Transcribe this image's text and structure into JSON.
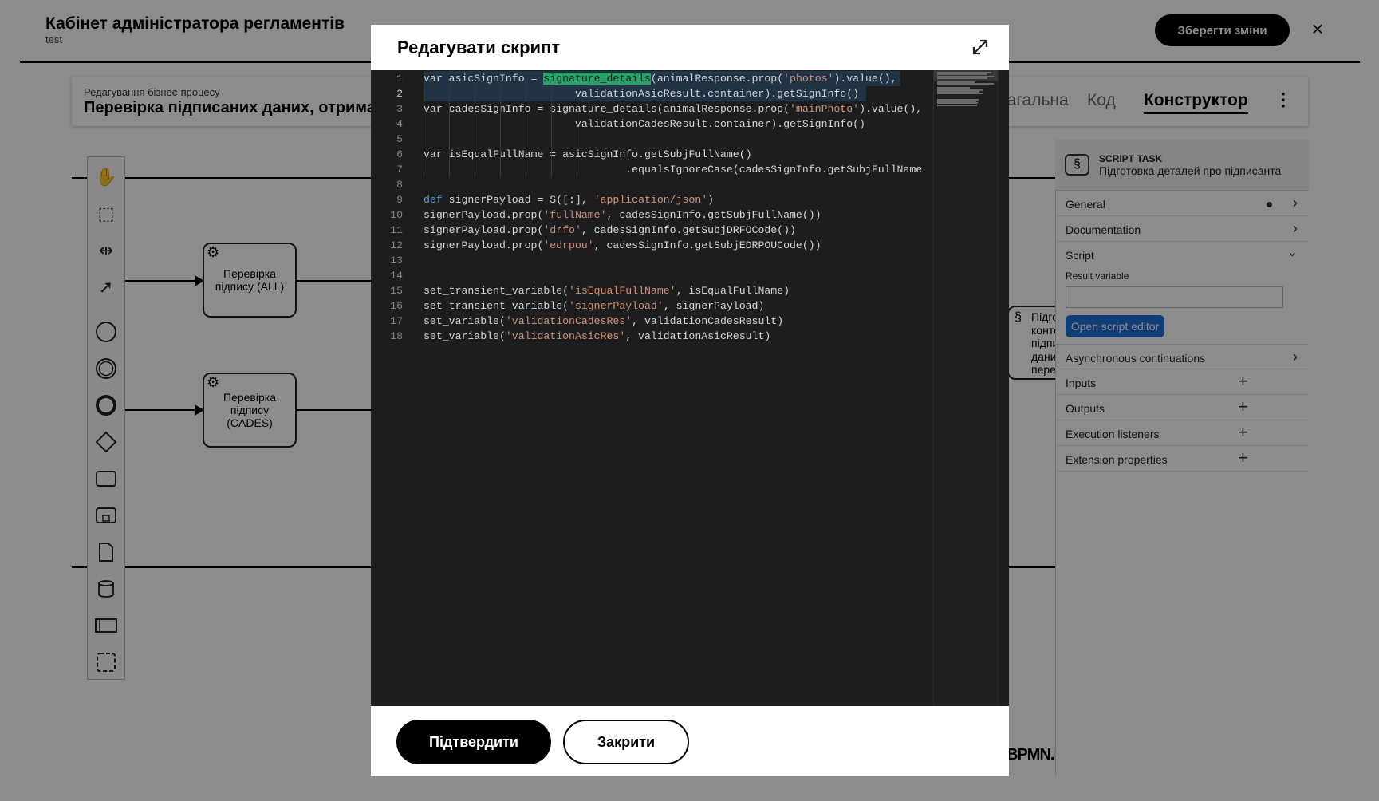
{
  "header": {
    "title": "Кабінет адміністратора регламентів",
    "subtitle": "test",
    "save_label": "Зберегти зміни",
    "close_glyph": "×"
  },
  "process": {
    "label": "Редагування бізнес-процесу",
    "name": "Перевірка підписаних даних, отримання деталей про підписанта та перевірка"
  },
  "tabs": [
    {
      "label": "Загальна"
    },
    {
      "label": "Код"
    },
    {
      "label": "Конструктор",
      "active": true
    }
  ],
  "menu_glyph": "⋮",
  "palette": {
    "tools": [
      "hand-tool-icon",
      "lasso-tool-icon",
      "space-tool-icon",
      "connect-tool-icon",
      "start-event-icon",
      "intermediate-event-icon",
      "end-event-icon",
      "gateway-icon",
      "task-icon",
      "subprocess-icon",
      "data-object-icon",
      "data-store-icon",
      "pool-icon",
      "group-icon"
    ]
  },
  "diagram": {
    "task1": "Перевірка підпису (ALL)",
    "task2": "Перевірка підпису (CADES)",
    "task3_lines": [
      "Підго",
      "конте",
      "підпи",
      "дани",
      "пере"
    ],
    "watermark": "BPMN.iO"
  },
  "properties": {
    "type": "SCRIPT TASK",
    "name": "Підготовка деталей про підписанта",
    "groups": [
      {
        "label": "General",
        "control": "chevron",
        "dot": true
      },
      {
        "label": "Documentation",
        "control": "chevron"
      },
      {
        "label": "Script",
        "control": "chevron-down"
      },
      {
        "label": "Asynchronous continuations",
        "control": "chevron"
      },
      {
        "label": "Inputs",
        "control": "plus"
      },
      {
        "label": "Outputs",
        "control": "plus"
      },
      {
        "label": "Execution listeners",
        "control": "plus"
      },
      {
        "label": "Extension properties",
        "control": "plus"
      }
    ],
    "result_variable_label": "Result variable",
    "result_variable_value": "",
    "open_editor_label": "Open script editor"
  },
  "modal": {
    "title": "Редагувати скрипт",
    "confirm_label": "Підтвердити",
    "close_label": "Закрити",
    "active_line": 2,
    "code_lines": [
      [
        {
          "t": "var asicSignInfo = "
        },
        {
          "t": "signature_details",
          "c": "hl"
        },
        {
          "t": "(animalResponse.prop("
        },
        {
          "t": "'photos'",
          "c": "str"
        },
        {
          "t": ").value(),"
        }
      ],
      [
        {
          "t": "                        validationAsicResult.container).getSignInfo()"
        }
      ],
      [
        {
          "t": "var cadesSignInfo = signature_details(animalResponse.prop("
        },
        {
          "t": "'mainPhoto'",
          "c": "str"
        },
        {
          "t": ").value(),"
        }
      ],
      [
        {
          "t": "                        validationCadesResult.container).getSignInfo()"
        }
      ],
      [
        {
          "t": ""
        }
      ],
      [
        {
          "t": "var isEqualFullName = asicSignInfo.getSubjFullName()"
        }
      ],
      [
        {
          "t": "                                .equalsIgnoreCase(cadesSignInfo.getSubjFullName"
        }
      ],
      [
        {
          "t": ""
        }
      ],
      [
        {
          "t": "def",
          "c": "kw"
        },
        {
          "t": " signerPayload = S([:], "
        },
        {
          "t": "'application/json'",
          "c": "str"
        },
        {
          "t": ")"
        }
      ],
      [
        {
          "t": "signerPayload.prop("
        },
        {
          "t": "'fullName'",
          "c": "str"
        },
        {
          "t": ", cadesSignInfo.getSubjFullName())"
        }
      ],
      [
        {
          "t": "signerPayload.prop("
        },
        {
          "t": "'drfo'",
          "c": "str"
        },
        {
          "t": ", cadesSignInfo.getSubjDRFOCode())"
        }
      ],
      [
        {
          "t": "signerPayload.prop("
        },
        {
          "t": "'edrpou'",
          "c": "str"
        },
        {
          "t": ", cadesSignInfo.getSubjEDRPOUCode())"
        }
      ],
      [
        {
          "t": ""
        }
      ],
      [
        {
          "t": ""
        }
      ],
      [
        {
          "t": "set_transient_variable("
        },
        {
          "t": "'isEqualFullName'",
          "c": "str"
        },
        {
          "t": ", isEqualFullName)"
        }
      ],
      [
        {
          "t": "set_transient_variable("
        },
        {
          "t": "'signerPayload'",
          "c": "str"
        },
        {
          "t": ", signerPayload)"
        }
      ],
      [
        {
          "t": "set_variable("
        },
        {
          "t": "'validationCadesRes'",
          "c": "str"
        },
        {
          "t": ", validationCadesResult)"
        }
      ],
      [
        {
          "t": "set_variable("
        },
        {
          "t": "'validationAsicRes'",
          "c": "str"
        },
        {
          "t": ", validationAsicResult)"
        }
      ]
    ]
  },
  "colors": {
    "accent_blue": "#1e6fd9",
    "editor_bg": "#1e1e1e",
    "string": "#ce9178",
    "keyword": "#569cd6",
    "match_highlight": "#26a269"
  }
}
